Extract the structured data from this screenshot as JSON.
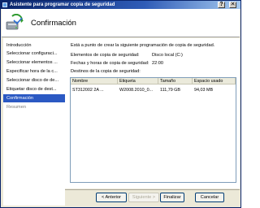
{
  "window": {
    "title": "Asistente para programar copia de seguridad",
    "help_glyph": "?",
    "close_glyph": "✕"
  },
  "header": {
    "title": "Confirmación"
  },
  "sidebar": {
    "steps": [
      {
        "label": "Introducción",
        "state": "done"
      },
      {
        "label": "Seleccionar configuraci...",
        "state": "done"
      },
      {
        "label": "Seleccionar elementos ...",
        "state": "done"
      },
      {
        "label": "Especificar hora de la c...",
        "state": "done"
      },
      {
        "label": "Seleccionar disco de de...",
        "state": "done"
      },
      {
        "label": "Etiquetar disco de dest...",
        "state": "done"
      },
      {
        "label": "Confirmación",
        "state": "active"
      },
      {
        "label": "Resumen",
        "state": "pending"
      }
    ]
  },
  "content": {
    "intro": "Está a punto de crear la siguiente programación de copia de seguridad.",
    "items_label": "Elementos de copia de seguridad:",
    "items_value": "Disco local (C:)",
    "times_label": "Fechas y horas de copia de seguridad:",
    "times_value": "22:00",
    "dest_label": "Destinos de la copia de seguridad:",
    "table": {
      "columns": [
        "Nombre",
        "Etiqueta",
        "Tamaño",
        "Espacio usado"
      ],
      "rows": [
        [
          "ST312002 2A ...",
          "W2008.2010_0...",
          "111,79 GB",
          "94,03 MB"
        ]
      ]
    }
  },
  "buttons": {
    "back": "< Anterior",
    "next": "Siguiente >",
    "finish": "Finalizar",
    "cancel": "Cancelar"
  },
  "colors": {
    "active_step": "#2b59c3",
    "titlebar": "#0a246a"
  }
}
